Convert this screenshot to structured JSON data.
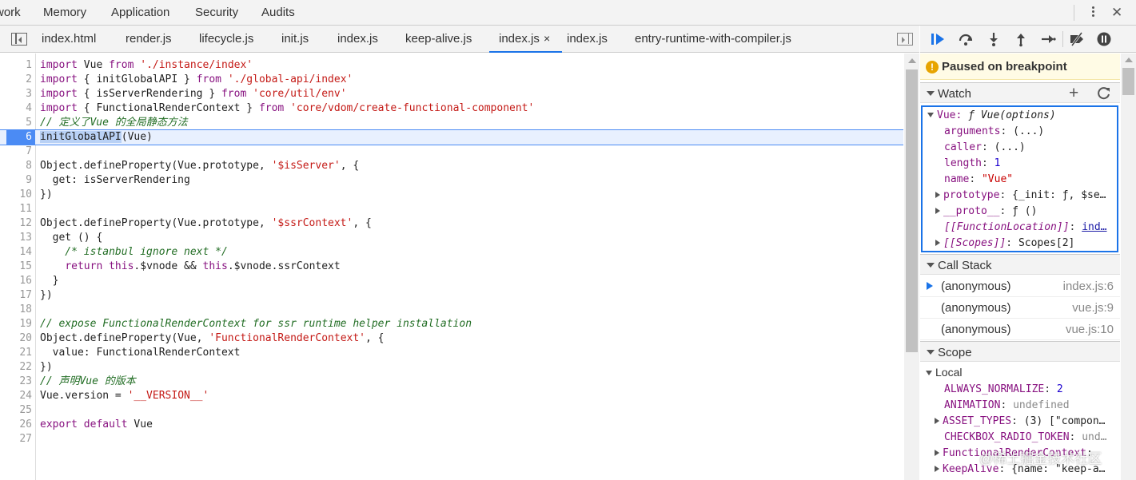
{
  "top_tabs": [
    "work",
    "Memory",
    "Application",
    "Security",
    "Audits"
  ],
  "file_tabs": [
    "index.html",
    "render.js",
    "lifecycle.js",
    "init.js",
    "index.js",
    "keep-alive.js",
    "index.js",
    "index.js",
    "entry-runtime-with-compiler.js"
  ],
  "active_file_tab_close": "×",
  "code": {
    "exec_line": 6,
    "lines": [
      {
        "n": "1",
        "t": "import Vue from './instance/index'"
      },
      {
        "n": "2",
        "t": "import { initGlobalAPI } from './global-api/index'"
      },
      {
        "n": "3",
        "t": "import { isServerRendering } from 'core/util/env'"
      },
      {
        "n": "4",
        "t": "import { FunctionalRenderContext } from 'core/vdom/create-functional-component'"
      },
      {
        "n": "5",
        "t": "// 定义了Vue 的全局静态方法"
      },
      {
        "n": "6",
        "t": "initGlobalAPI(Vue)"
      },
      {
        "n": "7",
        "t": ""
      },
      {
        "n": "8",
        "t": "Object.defineProperty(Vue.prototype, '$isServer', {"
      },
      {
        "n": "9",
        "t": "  get: isServerRendering"
      },
      {
        "n": "10",
        "t": "})"
      },
      {
        "n": "11",
        "t": ""
      },
      {
        "n": "12",
        "t": "Object.defineProperty(Vue.prototype, '$ssrContext', {"
      },
      {
        "n": "13",
        "t": "  get () {"
      },
      {
        "n": "14",
        "t": "    /* istanbul ignore next */"
      },
      {
        "n": "15",
        "t": "    return this.$vnode && this.$vnode.ssrContext"
      },
      {
        "n": "16",
        "t": "  }"
      },
      {
        "n": "17",
        "t": "})"
      },
      {
        "n": "18",
        "t": ""
      },
      {
        "n": "19",
        "t": "// expose FunctionalRenderContext for ssr runtime helper installation"
      },
      {
        "n": "20",
        "t": "Object.defineProperty(Vue, 'FunctionalRenderContext', {"
      },
      {
        "n": "21",
        "t": "  value: FunctionalRenderContext"
      },
      {
        "n": "22",
        "t": "})"
      },
      {
        "n": "23",
        "t": "// 声明Vue 的版本"
      },
      {
        "n": "24",
        "t": "Vue.version = '__VERSION__'"
      },
      {
        "n": "25",
        "t": ""
      },
      {
        "n": "26",
        "t": "export default Vue"
      },
      {
        "n": "27",
        "t": ""
      }
    ]
  },
  "debugger": {
    "paused_text": "Paused on breakpoint",
    "watch_title": "Watch",
    "watch_expr": "Vue:",
    "watch_type": "ƒ Vue(options)",
    "watch_props": [
      {
        "key": "arguments",
        "val": "(...)"
      },
      {
        "key": "caller",
        "val": "(...)"
      },
      {
        "key": "length",
        "val": "1"
      },
      {
        "key": "name",
        "val": "\"Vue\""
      },
      {
        "key": "prototype",
        "val": "{_init: ƒ, $se…"
      },
      {
        "key": "__proto__",
        "val": "ƒ ()"
      },
      {
        "key": "[[FunctionLocation]]",
        "val": "ind…"
      },
      {
        "key": "[[Scopes]]",
        "val": "Scopes[2]"
      }
    ],
    "callstack_title": "Call Stack",
    "frames": [
      {
        "fn": "(anonymous)",
        "loc": "index.js:6"
      },
      {
        "fn": "(anonymous)",
        "loc": "vue.js:9"
      },
      {
        "fn": "(anonymous)",
        "loc": "vue.js:10"
      }
    ],
    "scope_title": "Scope",
    "local_title": "Local",
    "scope_props": [
      {
        "key": "ALWAYS_NORMALIZE",
        "val": "2"
      },
      {
        "key": "ANIMATION",
        "val": "undefined"
      },
      {
        "key": "ASSET_TYPES",
        "val": "(3) [\"compon…"
      },
      {
        "key": "CHECKBOX_RADIO_TOKEN",
        "val": "und…"
      },
      {
        "key": "FunctionalRenderContext",
        "val": ""
      },
      {
        "key": "KeepAlive",
        "val": "{name: \"keep-a…"
      }
    ]
  },
  "watermark": "@稀土掘金技术社区"
}
